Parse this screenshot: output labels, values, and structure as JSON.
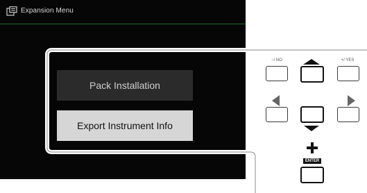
{
  "screen": {
    "title": "Expansion Menu",
    "title_icon": "expansion-icon",
    "menu_items": [
      {
        "label": "Pack Installation",
        "selected": false
      },
      {
        "label": "Export Instrument Info",
        "selected": true
      }
    ]
  },
  "panel": {
    "no_label": "−/ NO",
    "yes_label": "+/ YES",
    "enter_label": "ENTER",
    "icons": [
      "arrow-up-icon",
      "arrow-down-icon",
      "arrow-left-icon",
      "arrow-right-icon",
      "plus-icon"
    ]
  },
  "colors": {
    "screen_bg": "#060606",
    "title_rule": "#1f6b2a",
    "selected_bg": "#d6d6d6",
    "unselected_bg": "#2b2b2b"
  }
}
